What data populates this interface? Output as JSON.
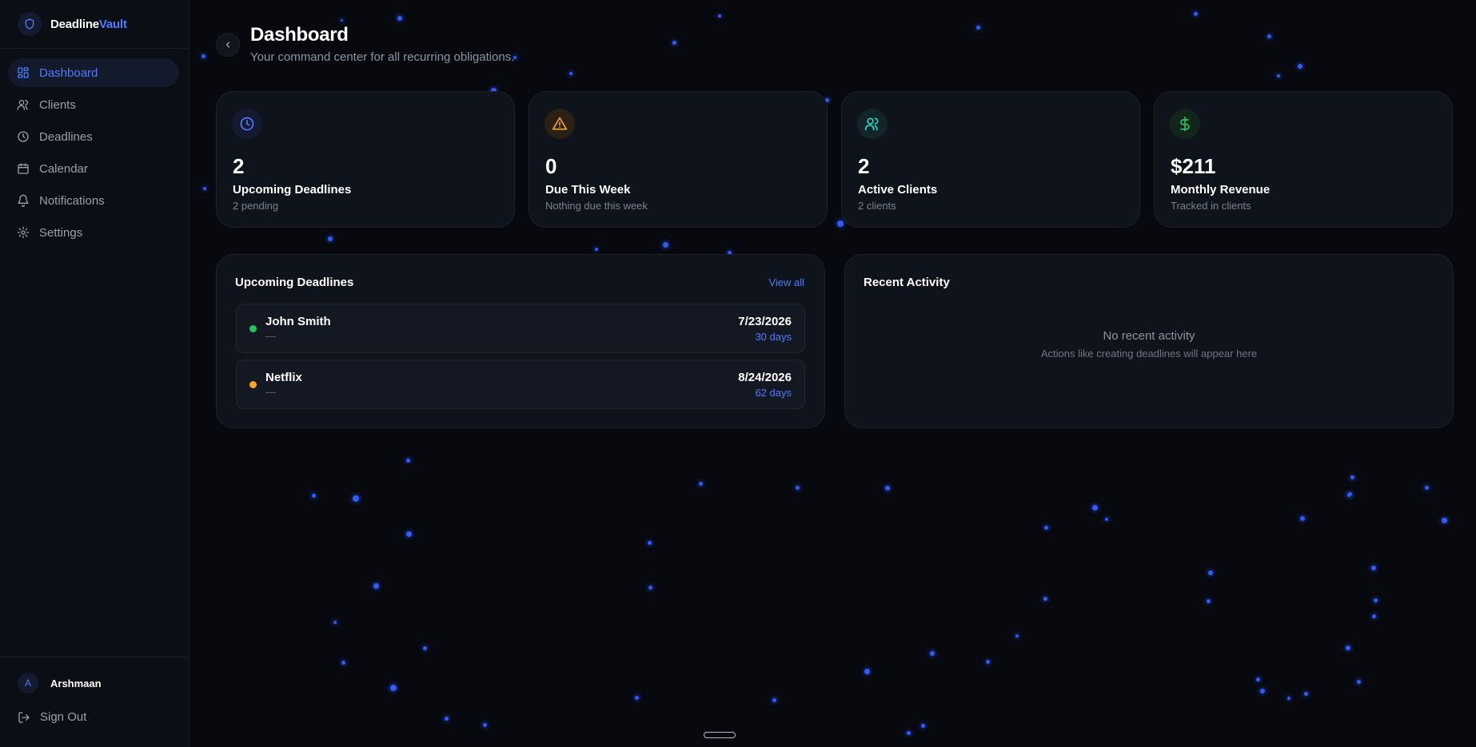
{
  "app": {
    "name_part1": "Deadline",
    "name_part2": "Vault"
  },
  "sidebar": {
    "items": [
      {
        "label": "Dashboard",
        "icon": "dashboard-grid-icon",
        "active": true
      },
      {
        "label": "Clients",
        "icon": "users-icon"
      },
      {
        "label": "Deadlines",
        "icon": "clock-icon"
      },
      {
        "label": "Calendar",
        "icon": "calendar-icon"
      },
      {
        "label": "Notifications",
        "icon": "bell-icon"
      },
      {
        "label": "Settings",
        "icon": "gear-icon"
      }
    ],
    "user": {
      "initial": "A",
      "name": "Arshmaan"
    },
    "signout_label": "Sign Out"
  },
  "header": {
    "title": "Dashboard",
    "subtitle": "Your command center for all recurring obligations."
  },
  "stats": [
    {
      "value": "2",
      "label": "Upcoming Deadlines",
      "sub": "2 pending",
      "icon": "clock-icon",
      "color": "#4d7cff"
    },
    {
      "value": "0",
      "label": "Due This Week",
      "sub": "Nothing due this week",
      "icon": "warning-icon",
      "color": "#f5a623"
    },
    {
      "value": "2",
      "label": "Active Clients",
      "sub": "2 clients",
      "icon": "users-icon",
      "color": "#2dd4bf"
    },
    {
      "value": "$211",
      "label": "Monthly Revenue",
      "sub": "Tracked in clients",
      "icon": "dollar-icon",
      "color": "#22c55e"
    }
  ],
  "upcoming": {
    "title": "Upcoming Deadlines",
    "view_all": "View all",
    "rows": [
      {
        "name": "John Smith",
        "sub": "—",
        "date": "7/23/2026",
        "days": "30 days",
        "status_color": "#22c55e"
      },
      {
        "name": "Netflix",
        "sub": "—",
        "date": "8/24/2026",
        "days": "62 days",
        "status_color": "#f5a623"
      }
    ]
  },
  "activity": {
    "title": "Recent Activity",
    "empty_title": "No recent activity",
    "empty_sub": "Actions like creating deadlines will appear here"
  },
  "colors": {
    "accent": "#4d7cff",
    "background": "#07090e",
    "card": "#0f131b"
  }
}
